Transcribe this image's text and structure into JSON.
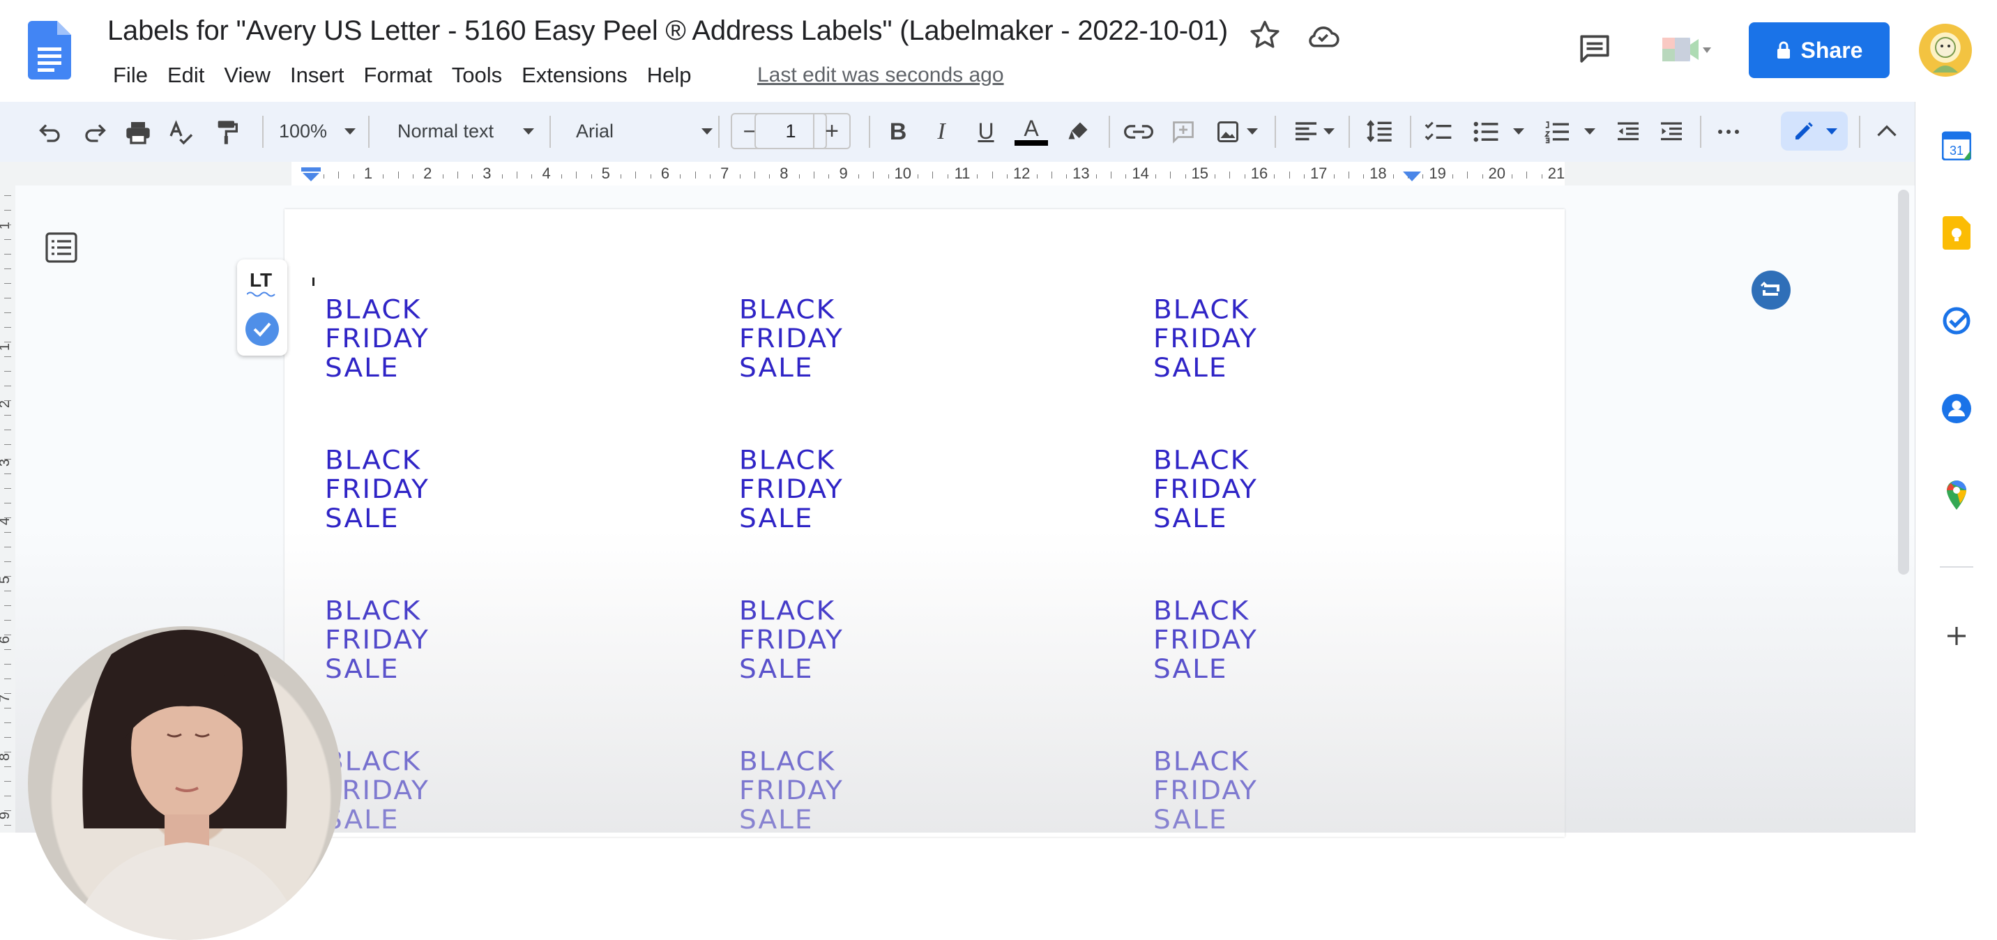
{
  "app": {
    "title": "Labels for \"Avery US Letter - 5160 Easy Peel ® Address Labels\" (Labelmaker - 2022-10-01)",
    "last_edit": "Last edit was seconds ago",
    "share_label": "Share"
  },
  "menu": [
    "File",
    "Edit",
    "View",
    "Insert",
    "Format",
    "Tools",
    "Extensions",
    "Help"
  ],
  "toolbar": {
    "zoom": "100%",
    "style": "Normal text",
    "font": "Arial",
    "font_size": "1",
    "minus": "−",
    "plus": "+",
    "bold": "B",
    "italic": "I",
    "underline": "U",
    "text_color": "A"
  },
  "ruler": {
    "numbers": [
      "1",
      "2",
      "3",
      "4",
      "5",
      "6",
      "7",
      "8",
      "9",
      "10",
      "11",
      "12",
      "13",
      "14",
      "15",
      "16",
      "17",
      "18",
      "19",
      "20",
      "21"
    ],
    "vertical_numbers": [
      "1",
      "1",
      "2",
      "3",
      "4",
      "5",
      "6",
      "7",
      "8",
      "9"
    ]
  },
  "lt_widget": {
    "logo": "LT"
  },
  "labels": {
    "line1": "BLACK",
    "line2": "FRIDAY",
    "line3": "SALE",
    "rows": 4,
    "cols": 3
  },
  "side_panel": {
    "calendar_day": "31"
  },
  "colors": {
    "accent": "#1a73e8",
    "label_text": "#2f24c6",
    "toolbar_bg": "#edf2fa"
  }
}
